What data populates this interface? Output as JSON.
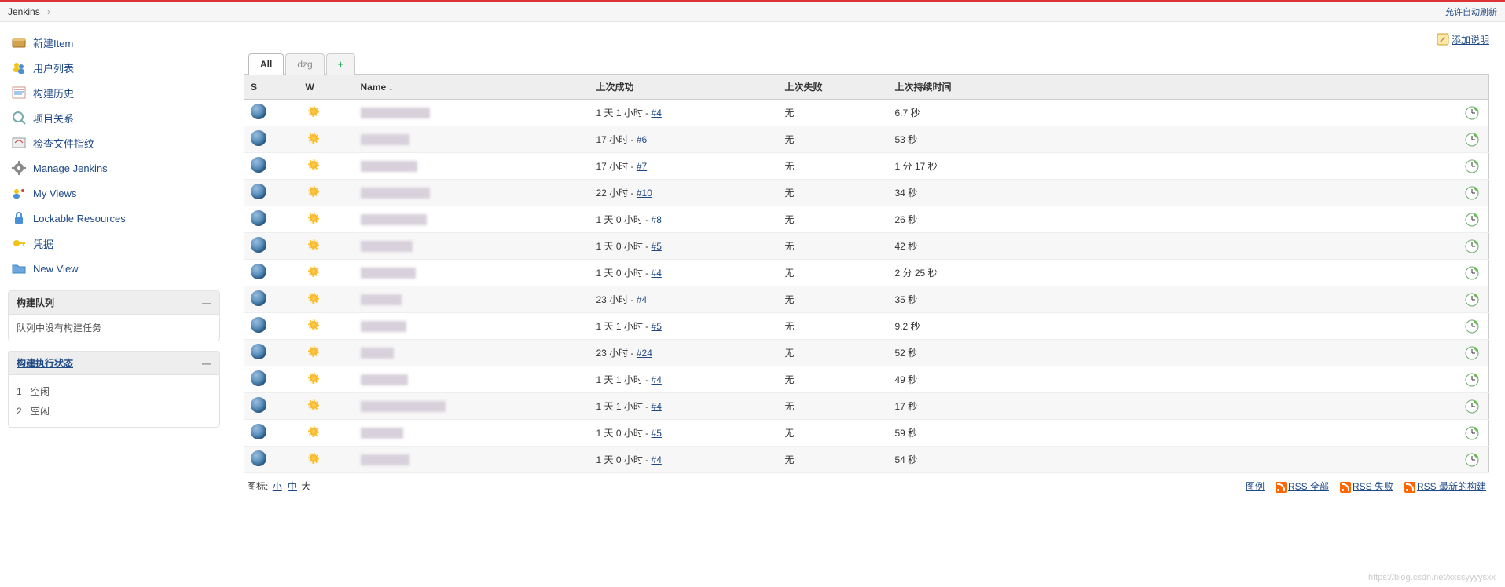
{
  "breadcrumb": {
    "root": "Jenkins"
  },
  "header": {
    "autorefresh": "允许自动刷新",
    "add_description": "添加说明"
  },
  "sidebar": {
    "items": [
      {
        "label": "新建Item",
        "icon": "new-item"
      },
      {
        "label": "用户列表",
        "icon": "people"
      },
      {
        "label": "构建历史",
        "icon": "history"
      },
      {
        "label": "项目关系",
        "icon": "relations"
      },
      {
        "label": "检查文件指纹",
        "icon": "fingerprint"
      },
      {
        "label": "Manage Jenkins",
        "icon": "gear"
      },
      {
        "label": "My Views",
        "icon": "my-views"
      },
      {
        "label": "Lockable Resources",
        "icon": "lock"
      },
      {
        "label": "凭据",
        "icon": "credentials"
      },
      {
        "label": "New View",
        "icon": "folder-plus"
      }
    ]
  },
  "queue": {
    "title": "构建队列",
    "empty": "队列中没有构建任务"
  },
  "executor": {
    "title": "构建执行状态",
    "rows": [
      {
        "num": "1",
        "state": "空闲"
      },
      {
        "num": "2",
        "state": "空闲"
      }
    ]
  },
  "tabs": {
    "all": "All",
    "other": "dzg",
    "plus": "+"
  },
  "columns": {
    "s": "S",
    "w": "W",
    "name": "Name  ↓",
    "last_success": "上次成功",
    "last_failure": "上次失败",
    "last_duration": "上次持续时间"
  },
  "jobs": [
    {
      "name_w": 88,
      "last_success": "1 天 1 小时",
      "build": "#4",
      "last_failure": "无",
      "duration": "6.7 秒"
    },
    {
      "name_w": 62,
      "last_success": "17 小时",
      "build": "#6",
      "last_failure": "无",
      "duration": "53 秒"
    },
    {
      "name_w": 72,
      "last_success": "17 小时",
      "build": "#7",
      "last_failure": "无",
      "duration": "1 分 17 秒"
    },
    {
      "name_w": 88,
      "last_success": "22 小时",
      "build": "#10",
      "last_failure": "无",
      "duration": "34 秒"
    },
    {
      "name_w": 84,
      "last_success": "1 天 0 小时",
      "build": "#8",
      "last_failure": "无",
      "duration": "26 秒"
    },
    {
      "name_w": 66,
      "last_success": "1 天 0 小时",
      "build": "#5",
      "last_failure": "无",
      "duration": "42 秒"
    },
    {
      "name_w": 70,
      "last_success": "1 天 0 小时",
      "build": "#4",
      "last_failure": "无",
      "duration": "2 分 25 秒"
    },
    {
      "name_w": 52,
      "last_success": "23 小时",
      "build": "#4",
      "last_failure": "无",
      "duration": "35 秒"
    },
    {
      "name_w": 58,
      "last_success": "1 天 1 小时",
      "build": "#5",
      "last_failure": "无",
      "duration": "9.2 秒"
    },
    {
      "name_w": 42,
      "last_success": "23 小时",
      "build": "#24",
      "last_failure": "无",
      "duration": "52 秒"
    },
    {
      "name_w": 60,
      "last_success": "1 天 1 小时",
      "build": "#4",
      "last_failure": "无",
      "duration": "49 秒"
    },
    {
      "name_w": 108,
      "last_success": "1 天 1 小时",
      "build": "#4",
      "last_failure": "无",
      "duration": "17 秒"
    },
    {
      "name_w": 54,
      "last_success": "1 天 0 小时",
      "build": "#5",
      "last_failure": "无",
      "duration": "59 秒"
    },
    {
      "name_w": 62,
      "last_success": "1 天 0 小时",
      "build": "#4",
      "last_failure": "无",
      "duration": "54 秒"
    }
  ],
  "iconsize": {
    "label": "图标:",
    "s": "小",
    "m": "中",
    "l": "大"
  },
  "footer": {
    "legend": "图例",
    "rss_all": "RSS 全部",
    "rss_fail": "RSS 失败",
    "rss_latest": "RSS 最新的构建"
  },
  "watermark": "https://blog.csdn.net/xxssyyyysxx"
}
